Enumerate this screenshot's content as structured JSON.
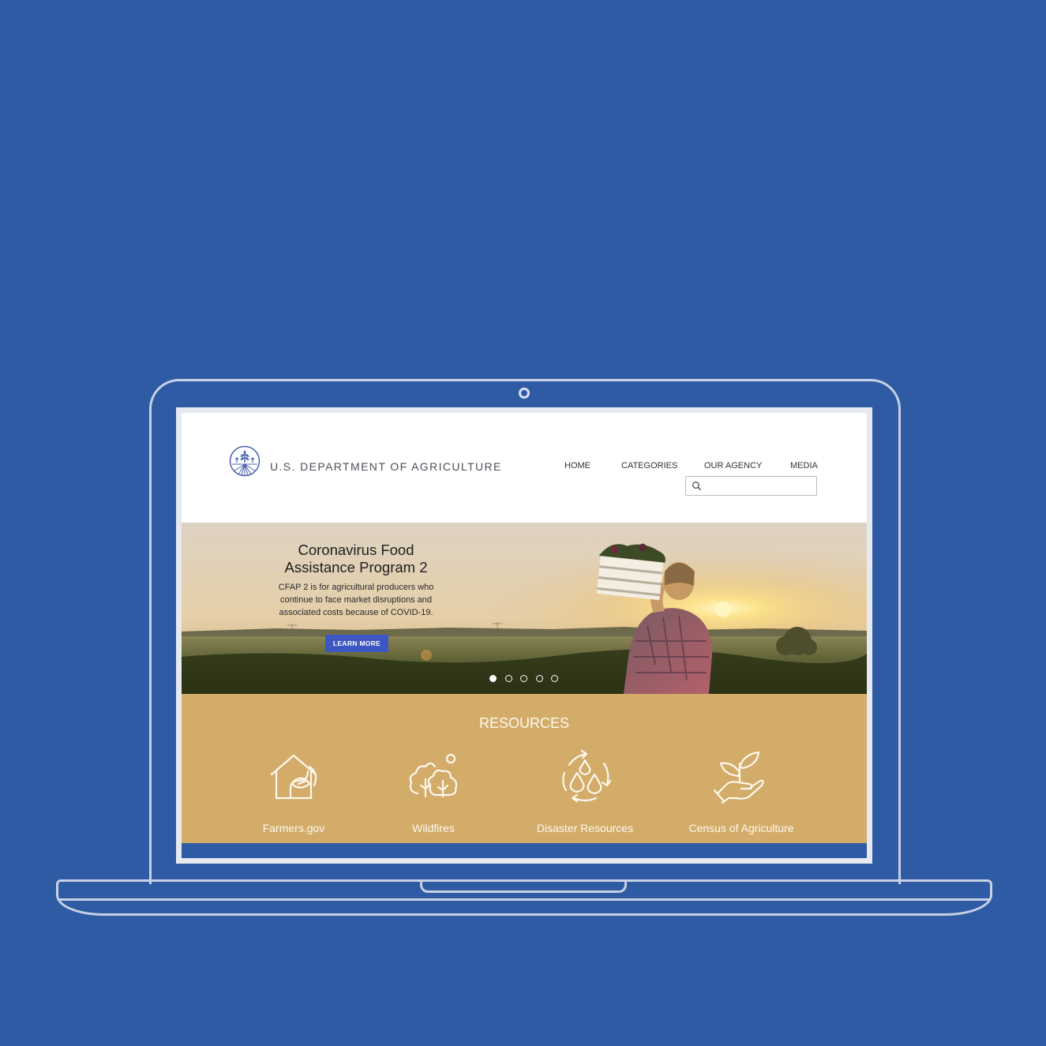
{
  "header": {
    "agency_name": "U.S. DEPARTMENT OF AGRICULTURE",
    "nav": {
      "home": "HOME",
      "categories": "CATEGORIES",
      "our_agency": "OUR AGENCY",
      "media": "MEDIA"
    },
    "search": {
      "value": "",
      "placeholder": ""
    }
  },
  "hero": {
    "title": "Coronavirus Food Assistance Program 2",
    "description": "CFAP 2 is for agricultural producers who continue to face market disruptions and associated costs because of COVID-19.",
    "button_label": "LEARN MORE",
    "slides_total": 5,
    "active_slide": 1
  },
  "resources": {
    "title": "RESOURCES",
    "items": [
      {
        "label": "Farmers.gov",
        "icon": "house-leaf-icon"
      },
      {
        "label": "Wildfires",
        "icon": "trees-icon"
      },
      {
        "label": "Disaster Resources",
        "icon": "water-cycle-icon"
      },
      {
        "label": "Census of Agriculture",
        "icon": "hand-plant-icon"
      }
    ]
  },
  "colors": {
    "background": "#2e5ba3",
    "button": "#3c57c2",
    "resources_bg": "#d3ac6a"
  }
}
